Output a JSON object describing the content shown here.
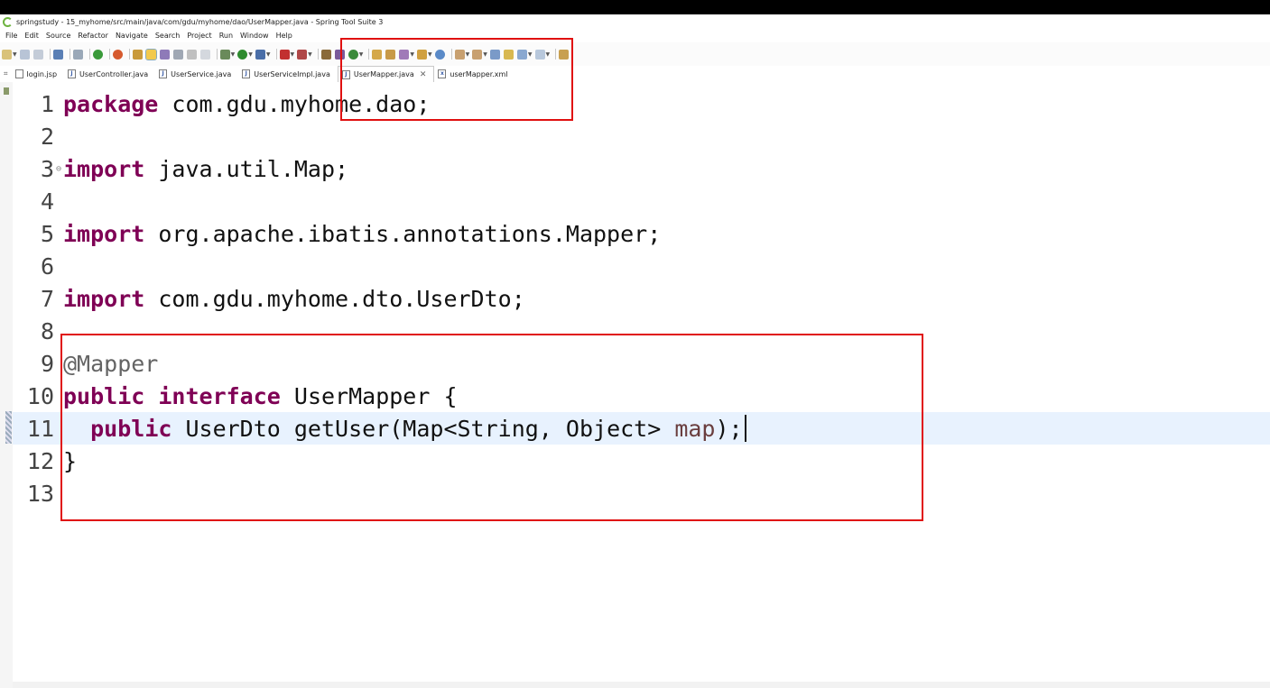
{
  "window": {
    "title": "springstudy - 15_myhome/src/main/java/com/gdu/myhome/dao/UserMapper.java - Spring Tool Suite 3"
  },
  "menu": [
    "File",
    "Edit",
    "Source",
    "Refactor",
    "Navigate",
    "Search",
    "Project",
    "Run",
    "Window",
    "Help"
  ],
  "tabs": [
    {
      "label": "login.jsp",
      "icon": "jsp-file-icon",
      "active": false
    },
    {
      "label": "UserController.java",
      "icon": "java-file-icon",
      "active": false
    },
    {
      "label": "UserService.java",
      "icon": "java-file-icon",
      "active": false
    },
    {
      "label": "UserServiceImpl.java",
      "icon": "java-file-icon",
      "active": false
    },
    {
      "label": "UserMapper.java",
      "icon": "java-file-icon",
      "active": true
    },
    {
      "label": "userMapper.xml",
      "icon": "xml-file-icon",
      "active": false
    }
  ],
  "editor": {
    "line_numbers": [
      "1",
      "2",
      "3",
      "4",
      "5",
      "6",
      "7",
      "8",
      "9",
      "10",
      "11",
      "12",
      "13"
    ],
    "current_line": "11",
    "lines": [
      [
        {
          "t": "package",
          "c": "kw"
        },
        {
          "t": " com.gdu.myhome.dao;",
          "c": ""
        }
      ],
      [],
      [
        {
          "t": "import",
          "c": "kw"
        },
        {
          "t": " java.util.Map;",
          "c": ""
        }
      ],
      [],
      [
        {
          "t": "import",
          "c": "kw"
        },
        {
          "t": " org.apache.ibatis.annotations.Mapper;",
          "c": ""
        }
      ],
      [],
      [
        {
          "t": "import",
          "c": "kw"
        },
        {
          "t": " com.gdu.myhome.dto.UserDto;",
          "c": ""
        }
      ],
      [],
      [
        {
          "t": "@Mapper",
          "c": "ann"
        }
      ],
      [
        {
          "t": "public",
          "c": "kw"
        },
        {
          "t": " ",
          "c": ""
        },
        {
          "t": "interface",
          "c": "kw"
        },
        {
          "t": " UserMapper {",
          "c": ""
        }
      ],
      [
        {
          "t": "  ",
          "c": ""
        },
        {
          "t": "public",
          "c": "kw"
        },
        {
          "t": " UserDto getUser(Map<String, Object> ",
          "c": ""
        },
        {
          "t": "map",
          "c": "param"
        },
        {
          "t": ");",
          "c": ""
        }
      ],
      [
        {
          "t": "}",
          "c": ""
        }
      ],
      []
    ]
  },
  "colors": {
    "keyword": "#7f0055",
    "annotation": "#646464",
    "parameter": "#6a3e3e",
    "current_line_bg": "#e8f2fe",
    "highlight_box": "#e01010"
  }
}
